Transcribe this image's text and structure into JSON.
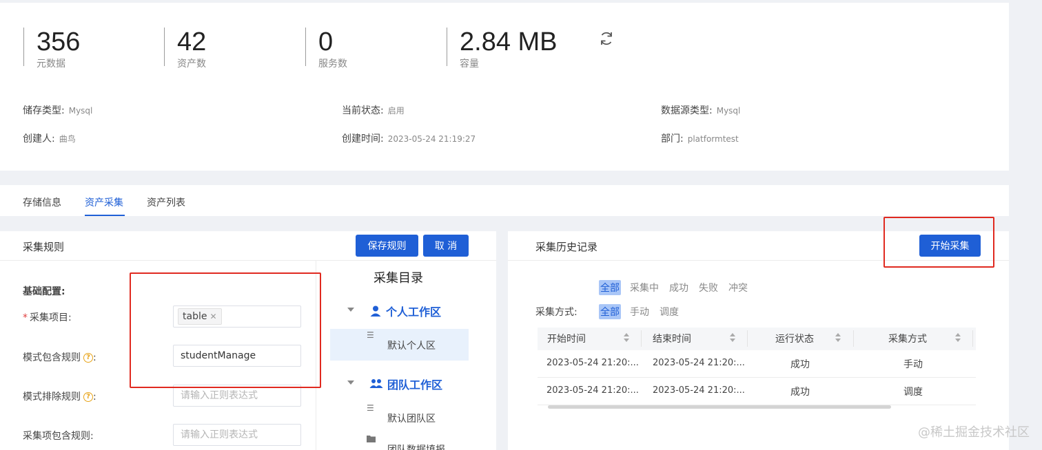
{
  "stats": [
    {
      "value": "356",
      "label": "元数据"
    },
    {
      "value": "42",
      "label": "资产数"
    },
    {
      "value": "0",
      "label": "服务数"
    },
    {
      "value": "2.84 MB",
      "label": "容量"
    }
  ],
  "info": {
    "storage_type_label": "储存类型:",
    "storage_type_value": "Mysql",
    "status_label": "当前状态:",
    "status_value": "启用",
    "ds_type_label": "数据源类型:",
    "ds_type_value": "Mysql",
    "creator_label": "创建人:",
    "creator_value": "曲鸟",
    "created_time_label": "创建时间:",
    "created_time_value": "2023-05-24 21:19:27",
    "dept_label": "部门:",
    "dept_value": "platformtest"
  },
  "tabs": [
    "存储信息",
    "资产采集",
    "资产列表"
  ],
  "rules": {
    "title": "采集规则",
    "save_label": "保存规则",
    "cancel_label": "取 消",
    "basic_config": "基础配置:",
    "item_label": "采集项目:",
    "item_tag": "table",
    "include_label": "模式包含规则",
    "include_value": "studentManage",
    "exclude_label": "模式排除规则",
    "exclude_placeholder": "请输入正则表达式",
    "item_include_label": "采集项包含规则:",
    "item_include_placeholder": "请输入正则表达式",
    "colon": ":"
  },
  "catalog": {
    "title": "采集目录",
    "personal_group": "个人工作区",
    "personal_item": "默认个人区",
    "team_group": "团队工作区",
    "team_item": "默认团队区",
    "team_item2": "团队数据填报"
  },
  "history": {
    "title": "采集历史记录",
    "start_label": "开始采集",
    "status_filters": [
      "全部",
      "采集中",
      "成功",
      "失败",
      "冲突"
    ],
    "method_label": "采集方式:",
    "method_filters": [
      "全部",
      "手动",
      "调度"
    ],
    "columns": [
      "开始时间",
      "结束时间",
      "运行状态",
      "采集方式"
    ],
    "rows": [
      {
        "start": "2023-05-24 21:20:...",
        "end": "2023-05-24 21:20:...",
        "status": "成功",
        "method": "手动"
      },
      {
        "start": "2023-05-24 21:20:...",
        "end": "2023-05-24 21:20:...",
        "status": "成功",
        "method": "调度"
      }
    ]
  },
  "watermark": "@稀土掘金技术社区",
  "colors": {
    "primary": "#1f5fd6",
    "highlight": "#e0291f",
    "background": "#eff1f5"
  }
}
